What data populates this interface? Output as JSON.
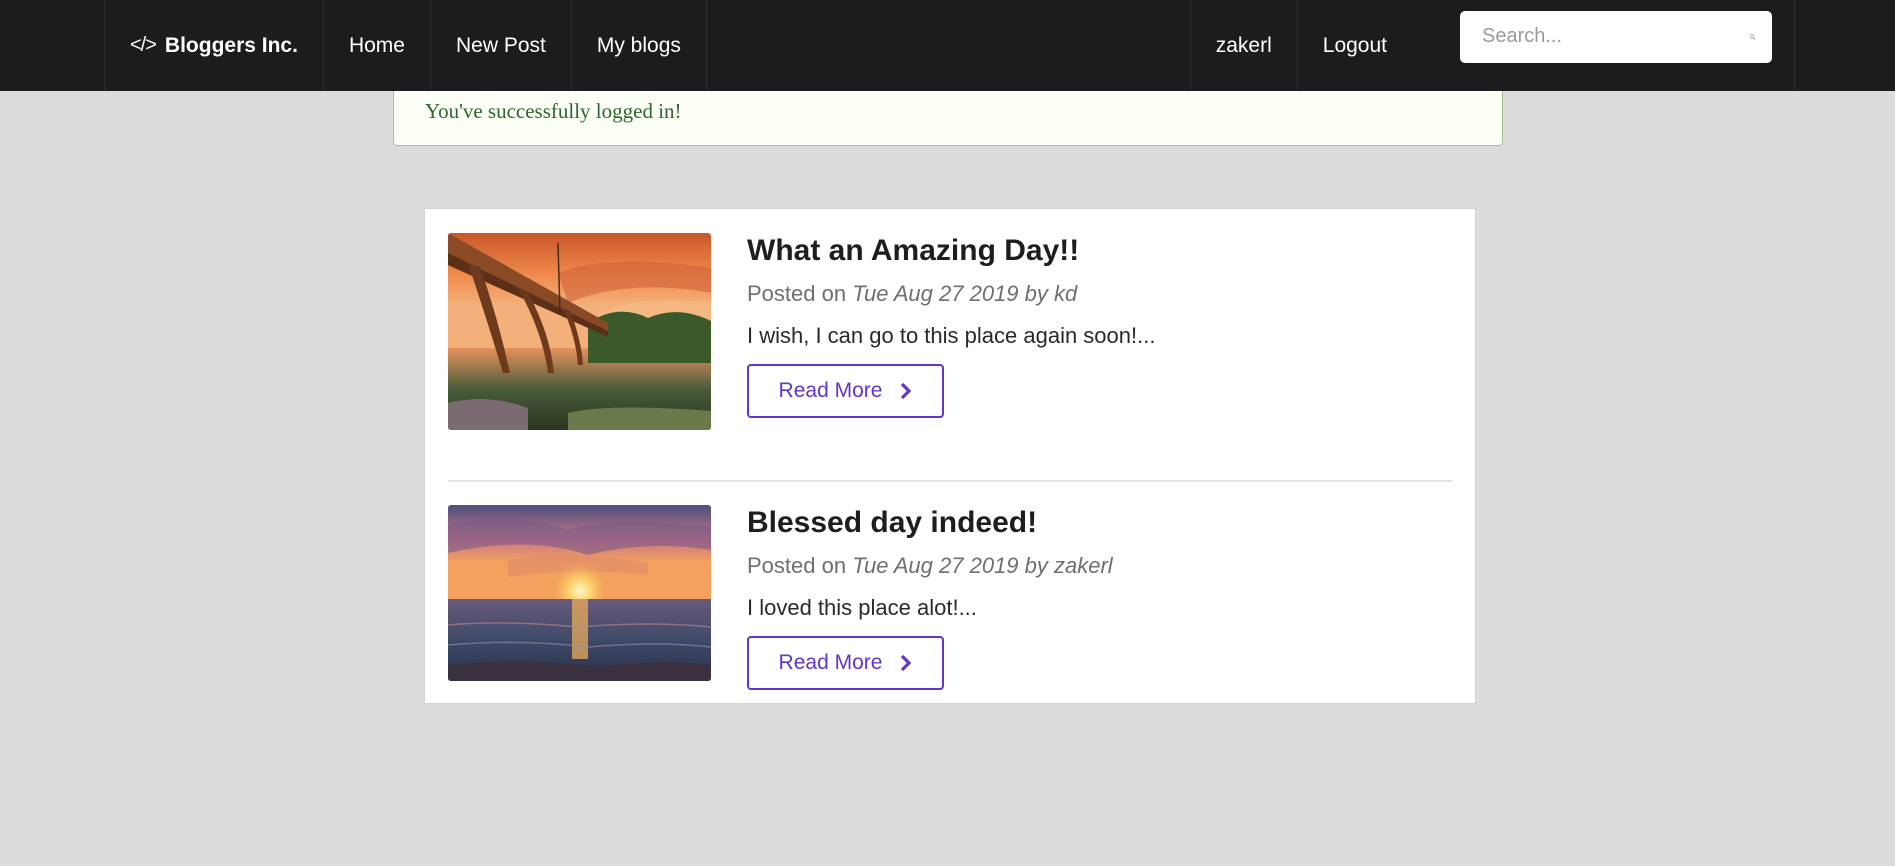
{
  "navbar": {
    "brand": "Bloggers Inc.",
    "brand_icon": "code-icon",
    "links": [
      "Home",
      "New Post",
      "My blogs"
    ],
    "username": "zakerl",
    "logout": "Logout",
    "search_placeholder": "Search...",
    "search_icon": "search-icon"
  },
  "flash": {
    "message": "You've successfully logged in!"
  },
  "posts": [
    {
      "title": "What an Amazing Day!!",
      "posted_prefix": "Posted on ",
      "date_author": "Tue Aug 27 2019 by kd",
      "excerpt": "I wish, I can go to this place again soon!...",
      "button": "Read More",
      "image": "bridge-sunset-photo"
    },
    {
      "title": "Blessed day indeed!",
      "posted_prefix": "Posted on ",
      "date_author": "Tue Aug 27 2019 by zakerl",
      "excerpt": "I loved this place alot!...",
      "button": "Read More",
      "image": "ocean-sunset-photo"
    }
  ],
  "colors": {
    "navbar": "#1b1c1d",
    "accent": "#6435c9",
    "flash_text": "#2c662d",
    "background": "#dcdcdc"
  }
}
